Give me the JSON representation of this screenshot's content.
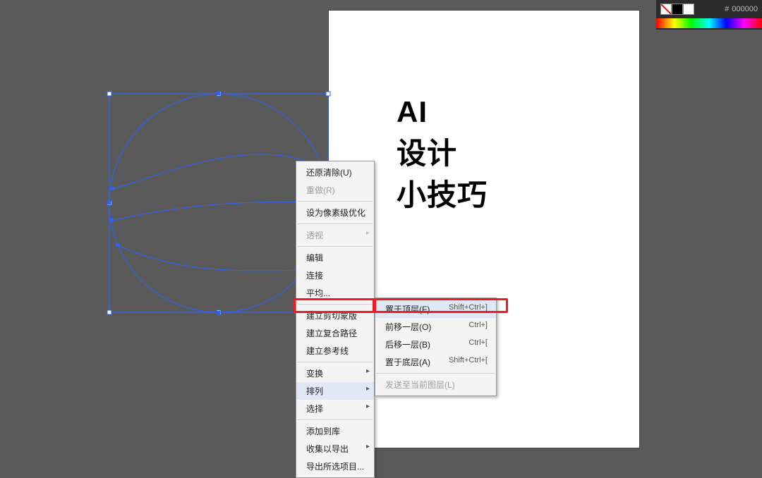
{
  "artboard": {
    "text_line1": "AI",
    "text_line2": "设计",
    "text_line3": "小技巧"
  },
  "panel": {
    "hex_prefix": "#",
    "hex_value": "000000"
  },
  "menu": {
    "undo": "还原清除(U)",
    "redo": "重做(R)",
    "pixel_opt": "设为像素级优化",
    "perspective": "透视",
    "edit": "编辑",
    "connect": "连接",
    "average": "平均...",
    "clip_mask": "建立剪切蒙版",
    "compound": "建立复合路径",
    "guides": "建立参考线",
    "transform": "变换",
    "arrange": "排列",
    "select": "选择",
    "add_lib": "添加到库",
    "collect_exp": "收集以导出",
    "export_sel": "导出所选项目..."
  },
  "submenu": {
    "bring_front": {
      "label": "置于顶层(F)",
      "shortcut": "Shift+Ctrl+]"
    },
    "bring_forward": {
      "label": "前移一层(O)",
      "shortcut": "Ctrl+]"
    },
    "send_backward": {
      "label": "后移一层(B)",
      "shortcut": "Ctrl+["
    },
    "send_back": {
      "label": "置于底层(A)",
      "shortcut": "Shift+Ctrl+["
    },
    "send_to_layer": {
      "label": "发送至当前图层(L)",
      "shortcut": ""
    }
  }
}
